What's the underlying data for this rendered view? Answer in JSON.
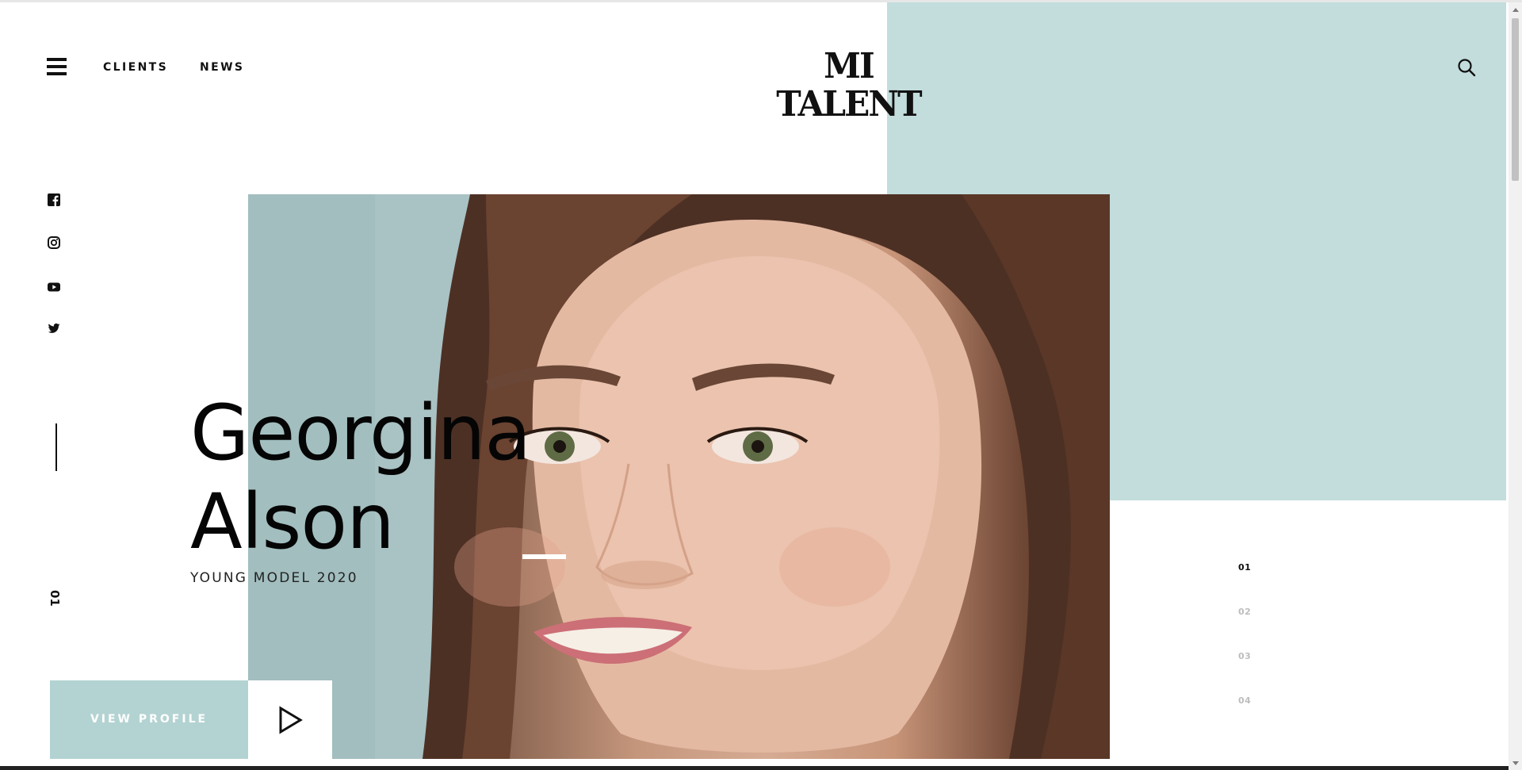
{
  "header": {
    "menu_icon": "hamburger-menu-icon",
    "nav": [
      {
        "label": "CLIENTS"
      },
      {
        "label": "NEWS"
      }
    ],
    "logo_text": "MI TALENT",
    "search_icon": "search-icon"
  },
  "social": [
    {
      "icon": "facebook-icon"
    },
    {
      "icon": "instagram-icon"
    },
    {
      "icon": "youtube-icon"
    },
    {
      "icon": "twitter-icon"
    }
  ],
  "slider": {
    "current_index_label": "01",
    "indicators": [
      "01",
      "02",
      "03",
      "04"
    ],
    "active_index": 0
  },
  "hero": {
    "name_line1": "Georgina",
    "name_line2": "Alson",
    "subtitle": "YOUNG MODEL 2020",
    "image": "portrait-photo-of-smiling-young-woman"
  },
  "actions": {
    "view_profile_label": "VIEW PROFILE",
    "play_icon": "play-icon"
  },
  "colors": {
    "mint_block": "#c3dcdc",
    "button_bg": "#b3d3d2",
    "text": "#111111",
    "inactive_indicator": "#bdbdbd"
  }
}
